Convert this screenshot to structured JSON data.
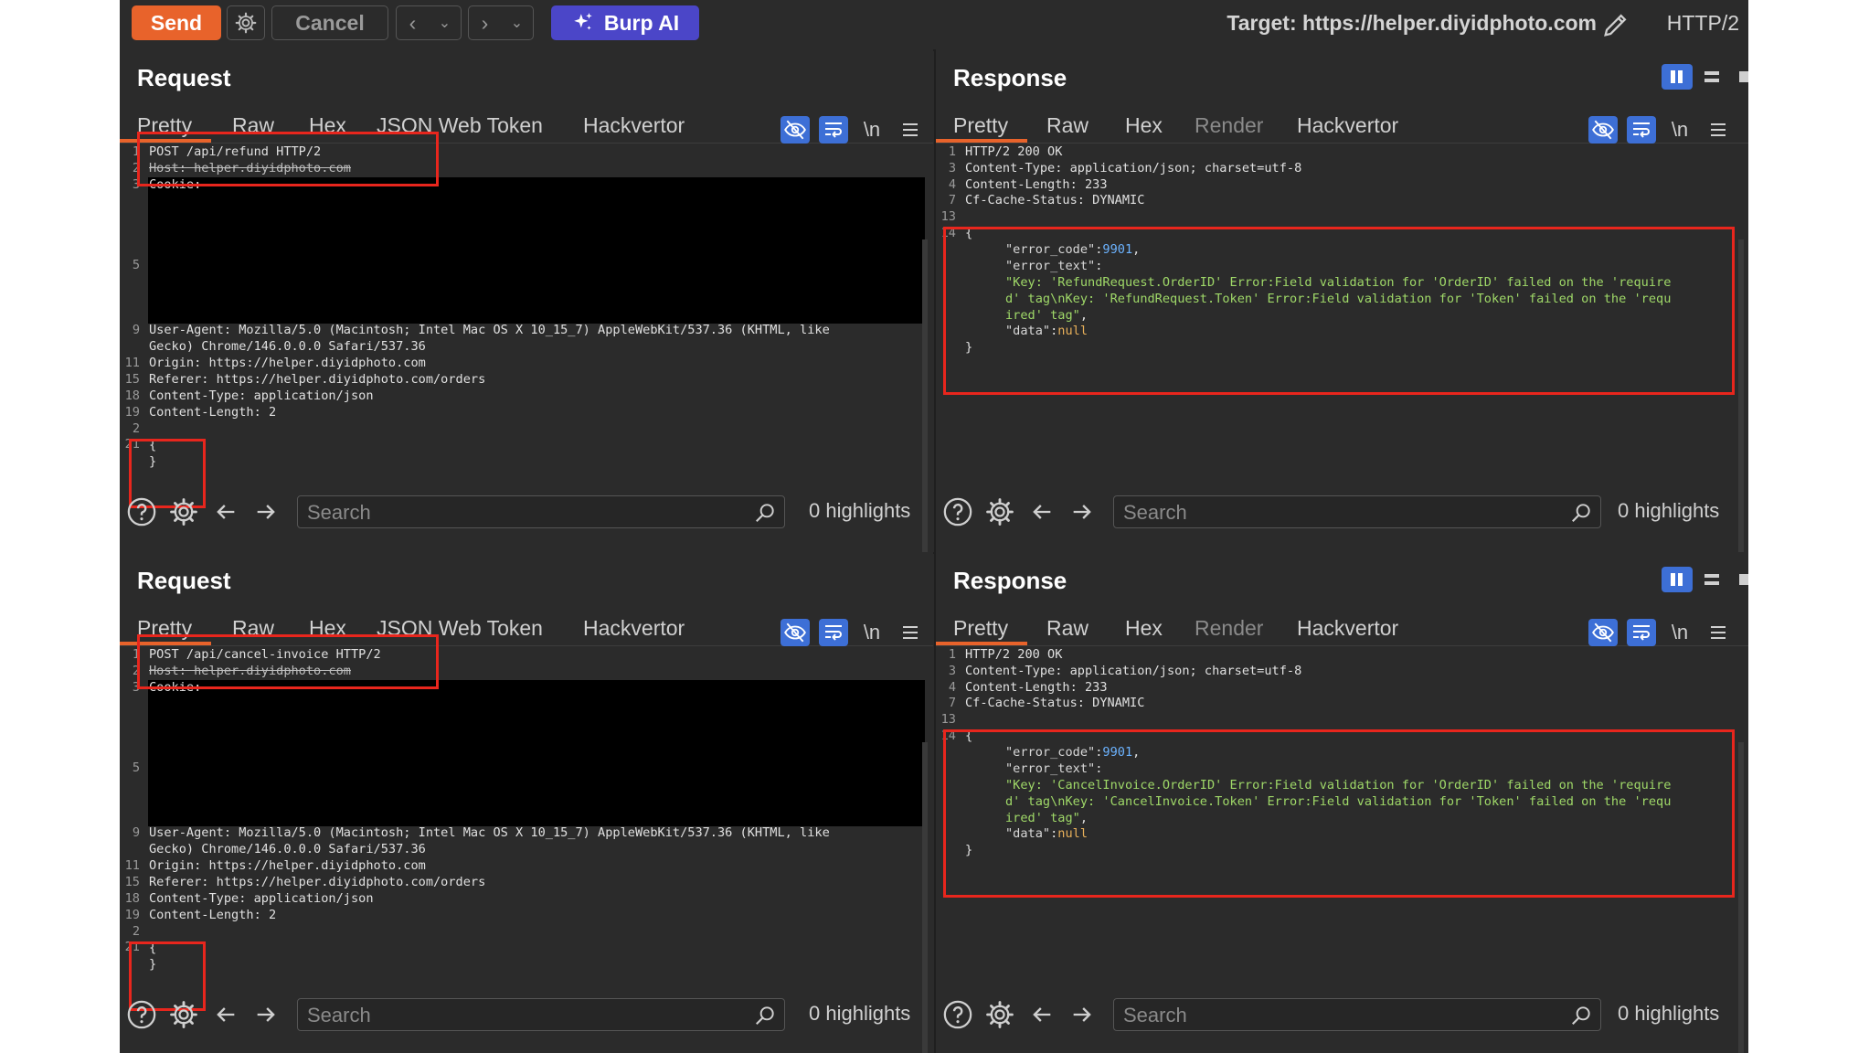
{
  "toolbar": {
    "send_label": "Send",
    "cancel_label": "Cancel",
    "burp_ai_label": "Burp AI",
    "target_label": "Target: https://helper.diyidphoto.com",
    "protocol_label": "HTTP/2"
  },
  "request_tabs": [
    "Pretty",
    "Raw",
    "Hex",
    "JSON Web Token",
    "Hackvertor"
  ],
  "response_tabs": [
    "Pretty",
    "Raw",
    "Hex",
    "Render",
    "Hackvertor"
  ],
  "newline_label": "\\n",
  "search_placeholder": "Search",
  "highlights_label": "0 highlights",
  "colors": {
    "accent": "#e8632b",
    "burp_ai": "#4b46c8",
    "toggle_on": "#3d6fd6",
    "annotation_box": "#e8261d"
  },
  "pairs": [
    {
      "request": {
        "title": "Request",
        "line_numbers": [
          "1",
          "2",
          "3",
          "5",
          "9",
          "11",
          "15",
          "18",
          "19",
          "2",
          "21"
        ],
        "lines": {
          "request_line": "POST /api/refund HTTP/2",
          "host": "Host: helper.diyidphoto.com",
          "cookie": "Cookie:",
          "ua1": "User-Agent: Mozilla/5.0 (Macintosh; Intel Mac OS X 10_15_7) AppleWebKit/537.36 (KHTML, like",
          "ua2": "Gecko) Chrome/146.0.0.0 Safari/537.36",
          "origin": "Origin: https://helper.diyidphoto.com",
          "referer": "Referer: https://helper.diyidphoto.com/orders",
          "ctype": "Content-Type: application/json",
          "clen": "Content-Length: 2",
          "open_brace": "{",
          "close_brace": "}"
        }
      },
      "response": {
        "title": "Response",
        "line_numbers": [
          "1",
          "3",
          "4",
          "7",
          "13",
          "14"
        ],
        "lines": {
          "status": "HTTP/2 200 OK",
          "ctype": "Content-Type: application/json; charset=utf-8",
          "clen": "Content-Length: 233",
          "cf": "Cf-Cache-Status: DYNAMIC",
          "open_brace": "{",
          "k_error_code": "\"error_code\"",
          "v_error_code": "9901",
          "k_error_text": "\"error_text\"",
          "v1": "\"Key: 'RefundRequest.OrderID' Error:Field validation for 'OrderID' failed on the 'require",
          "v2": "d' tag\\nKey: 'RefundRequest.Token' Error:Field validation for 'Token' failed on the 'requ",
          "v3": "ired' tag\"",
          "k_data": "\"data\"",
          "v_data": "null",
          "close_brace": "}"
        }
      }
    },
    {
      "request": {
        "title": "Request",
        "line_numbers": [
          "1",
          "2",
          "3",
          "5",
          "9",
          "11",
          "15",
          "18",
          "19",
          "2",
          "21"
        ],
        "lines": {
          "request_line": "POST /api/cancel-invoice HTTP/2",
          "host": "Host: helper.diyidphoto.com",
          "cookie": "Cookie:",
          "ua1": "User-Agent: Mozilla/5.0 (Macintosh; Intel Mac OS X 10_15_7) AppleWebKit/537.36 (KHTML, like",
          "ua2": "Gecko) Chrome/146.0.0.0 Safari/537.36",
          "origin": "Origin: https://helper.diyidphoto.com",
          "referer": "Referer: https://helper.diyidphoto.com/orders",
          "ctype": "Content-Type: application/json",
          "clen": "Content-Length: 2",
          "open_brace": "{",
          "close_brace": "}"
        }
      },
      "response": {
        "title": "Response",
        "line_numbers": [
          "1",
          "3",
          "4",
          "7",
          "13",
          "14"
        ],
        "lines": {
          "status": "HTTP/2 200 OK",
          "ctype": "Content-Type: application/json; charset=utf-8",
          "clen": "Content-Length: 233",
          "cf": "Cf-Cache-Status: DYNAMIC",
          "open_brace": "{",
          "k_error_code": "\"error_code\"",
          "v_error_code": "9901",
          "k_error_text": "\"error_text\"",
          "v1": "\"Key: 'CancelInvoice.OrderID' Error:Field validation for 'OrderID' failed on the 'require",
          "v2": "d' tag\\nKey: 'CancelInvoice.Token' Error:Field validation for 'Token' failed on the 'requ",
          "v3": "ired' tag\"",
          "k_data": "\"data\"",
          "v_data": "null",
          "close_brace": "}"
        }
      }
    }
  ]
}
